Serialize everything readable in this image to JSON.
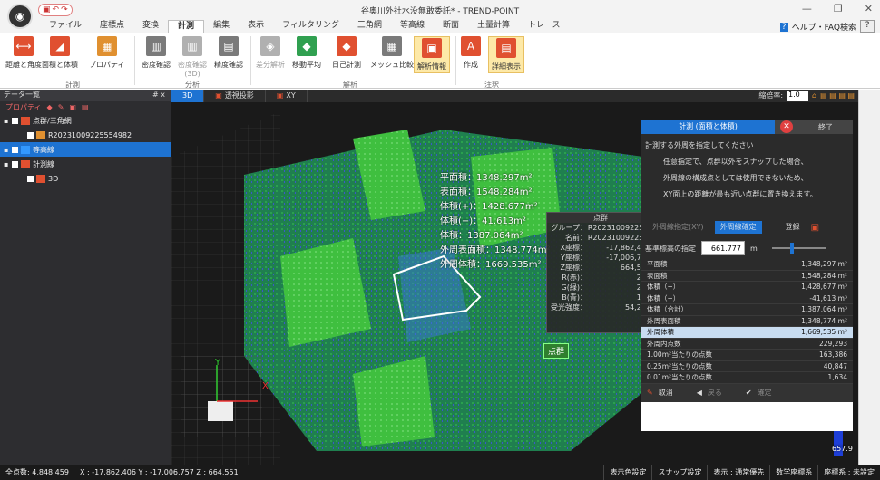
{
  "window": {
    "title": "谷奥川外社水没無敢委託* - TREND-POINT"
  },
  "menu": {
    "tabs": [
      "ファイル",
      "座標点",
      "変換",
      "計測",
      "編集",
      "表示",
      "フィルタリング",
      "三角網",
      "等高線",
      "断面",
      "土量計算",
      "トレース"
    ],
    "active": 3,
    "help": "ヘルプ・FAQ検索"
  },
  "ribbon": {
    "buttons": [
      {
        "label": "距離と角度",
        "color": "#e05030"
      },
      {
        "label": "面積と体積",
        "color": "#e05030"
      },
      {
        "label": "プロパティ",
        "color": "#e09030"
      },
      {
        "label": "密度確認",
        "color": "#7a7a7a"
      },
      {
        "label": "密度確認",
        "color": "#b0b0b0"
      },
      {
        "label": "精度確認",
        "color": "#7a7a7a"
      },
      {
        "label": "差分解析",
        "color": "#b0b0b0"
      },
      {
        "label": "移動平均",
        "color": "#30a050"
      },
      {
        "label": "日己計測",
        "color": "#e05030"
      },
      {
        "label": "メッシュ比較",
        "color": "#7a7a7a"
      },
      {
        "label": "解析情報",
        "color": "#e05030"
      },
      {
        "label": "作成",
        "color": "#e05030"
      },
      {
        "label": "詳細表示",
        "color": "#e05030"
      }
    ],
    "sub_label": "(3D)",
    "groups": [
      "計測",
      "分析",
      "解析",
      "注釈"
    ]
  },
  "left_panel": {
    "title": "データ一覧",
    "pin": "# x",
    "toolbar": "プロパティ",
    "items": [
      {
        "label": "点群/三角網",
        "selected": false
      },
      {
        "label": "R20231009225554982",
        "selected": false
      },
      {
        "label": "等高線",
        "selected": true
      },
      {
        "label": "計測線",
        "selected": false
      },
      {
        "label": "3D",
        "selected": false
      }
    ]
  },
  "view": {
    "tabs": [
      "3D",
      "透視投影",
      "XY"
    ],
    "zoom_label": "縮倍率:",
    "zoom": "1.0",
    "results": [
      "平面積：1348.297m²",
      "表面積：1548.284m²",
      "体積(+)：1428.677m²",
      "体積(−)：41.613m²",
      "体積：1387.064m²",
      "外周表面積：1348.774m²",
      "外周体積：1669.535m²"
    ],
    "axis_y": "Y",
    "axis_x": "X",
    "scale_label": "657.9",
    "point_label": "点群"
  },
  "point_info": {
    "title": "点群",
    "rows": [
      {
        "k": "グループ：",
        "v": "R20231009225..."
      },
      {
        "k": "名前：",
        "v": "R20231009225..."
      },
      {
        "k": "X座標：",
        "v": "-17,862,406"
      },
      {
        "k": "Y座標：",
        "v": "-17,006,757"
      },
      {
        "k": "Z座標：",
        "v": "664,551"
      },
      {
        "k": "R(赤)：",
        "v": "223"
      },
      {
        "k": "G(緑)：",
        "v": "211"
      },
      {
        "k": "B(青)：",
        "v": "187"
      },
      {
        "k": "受光強度：",
        "v": "54,227"
      }
    ]
  },
  "measure": {
    "title": "計測 (面積と体積)",
    "end": "終了",
    "instructions": [
      "計測する外周を指定してください",
      "任意指定で、点群以外をスナップした場合、",
      "外周線の構成点としては使用できないため、",
      "XY面上の距離が最も近い点群に置き換えます。"
    ],
    "btn1": "外周線指定(XY)",
    "btn2": "外周線確定",
    "btn3": "登録",
    "base_label": "基準標高の指定",
    "base_value": "661.777",
    "base_unit": "m",
    "rows": [
      {
        "k": "平面積",
        "v": "1,348,297 m²"
      },
      {
        "k": "表面積",
        "v": "1,548,284 m²"
      },
      {
        "k": "体積（+）",
        "v": "1,428,677 m³"
      },
      {
        "k": "体積（−）",
        "v": "-41,613 m³"
      },
      {
        "k": "体積（合計）",
        "v": "1,387,064 m³"
      },
      {
        "k": "外周表面積",
        "v": "1,348,774 m²"
      },
      {
        "k": "外周体積",
        "v": "1,669,535 m³"
      },
      {
        "k": "外周内点数",
        "v": "229,293"
      },
      {
        "k": "1.00m²当たりの点数",
        "v": "163,386"
      },
      {
        "k": "0.25m²当たりの点数",
        "v": "40,847"
      },
      {
        "k": "0.01m²当たりの点数",
        "v": "1,634"
      }
    ],
    "footer": [
      "取消",
      "戻る",
      "確定"
    ]
  },
  "status": {
    "points": "全点数: 4,848,459",
    "coords": "X : -17,862,406  Y : -17,006,757  Z : 664,551",
    "buttons": [
      "表示色設定",
      "スナップ設定",
      "表示 : 通常優先",
      "数学座標系",
      "座標系 : 未設定"
    ]
  }
}
